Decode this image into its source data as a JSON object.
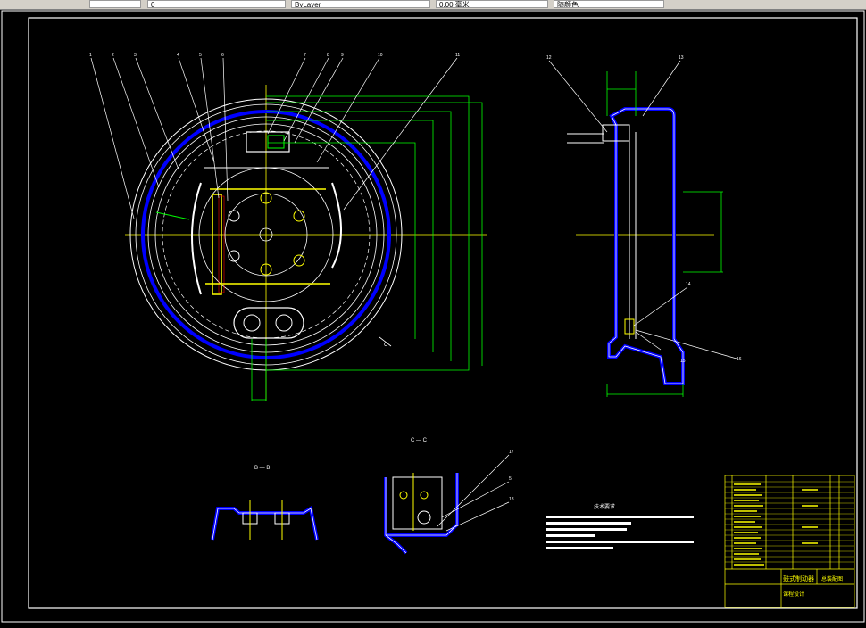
{
  "toolbar": {
    "layer_field": "0",
    "linetype_field": "ByLayer",
    "lineweight_field": "0.00 毫米",
    "plotstyle_field": "随颜色"
  },
  "drawing": {
    "section_bb_label": "B — B",
    "section_cc_label": "C — C",
    "view_c_label": "C",
    "tech_title": "技术要求",
    "callouts": [
      "1",
      "2",
      "3",
      "4",
      "5",
      "6",
      "7",
      "8",
      "9",
      "10",
      "11",
      "12",
      "13",
      "14",
      "15",
      "16",
      "17",
      "18"
    ],
    "title_block": {
      "drawing_name": "鼓式制动器",
      "drawing_sub": "总装配图",
      "company": "课程设计"
    }
  },
  "colors": {
    "frame": "#ffffff",
    "cyan_part": "#ffffff",
    "dim_green": "#00ff00",
    "hidden_blue": "#0000ff",
    "hatch_yellow": "#ffff00",
    "leader_white": "#ffffff",
    "title_block": "#ffff00",
    "callout_red": "#ff0000"
  }
}
